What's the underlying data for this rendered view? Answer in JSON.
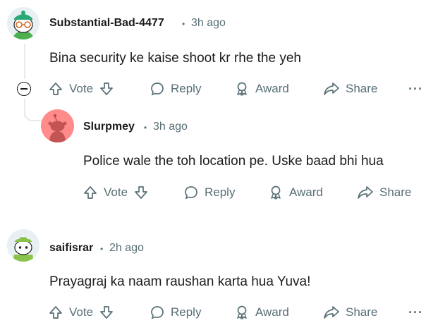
{
  "comments": [
    {
      "username": "Substantial-Bad-4477",
      "time": "3h ago",
      "text": "Bina security ke kaise shoot kr rhe the yeh",
      "actions": {
        "vote": "Vote",
        "reply": "Reply",
        "award": "Award",
        "share": "Share",
        "more": "···"
      }
    },
    {
      "username": "Slurpmey",
      "time": "3h ago",
      "text": "Police wale the toh location pe. Uske baad bhi hua",
      "actions": {
        "vote": "Vote",
        "reply": "Reply",
        "award": "Award",
        "share": "Share"
      }
    },
    {
      "username": "saifisrar",
      "time": "2h ago",
      "text": "Prayagraj ka naam raushan karta hua Yuva!",
      "actions": {
        "vote": "Vote",
        "reply": "Reply",
        "award": "Award",
        "share": "Share",
        "more": "···"
      }
    }
  ],
  "separator": "•",
  "colors": {
    "meta": "#576f76",
    "text": "#1c1c1c",
    "thread": "#e5ebee",
    "avatar2": "#ff8b8b"
  }
}
